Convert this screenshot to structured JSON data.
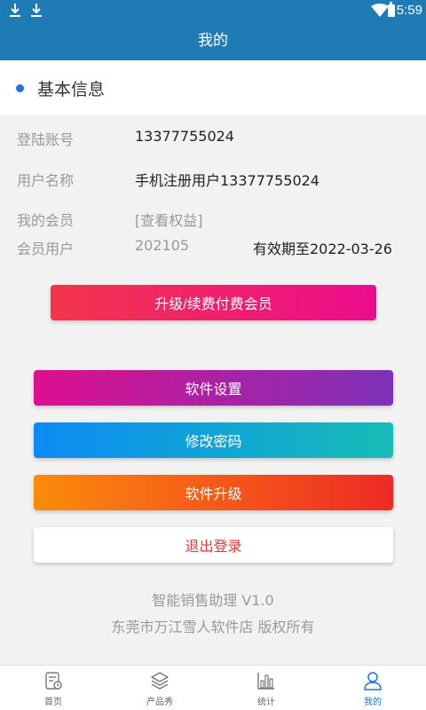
{
  "status_bar": {
    "time": "5:59"
  },
  "header": {
    "title": "我的"
  },
  "section": {
    "title": "基本信息"
  },
  "info": {
    "account_label": "登陆账号",
    "account_value": "13377755024",
    "username_label": "用户名称",
    "username_value": "手机注册用户13377755024",
    "membership_label": "我的会员",
    "membership_value": "[查看权益]",
    "member_user_label": "会员用户",
    "member_user_value": "202105",
    "expiry_text": "有效期至2022-03-26"
  },
  "buttons": {
    "upgrade": "升级/续费付费会员",
    "settings": "软件设置",
    "change_password": "修改密码",
    "software_update": "软件升级",
    "logout": "退出登录"
  },
  "footer": {
    "app_version": "智能销售助理 V1.0",
    "copyright": "东莞市万江雪人软件店 版权所有"
  },
  "tabbar": {
    "items": [
      {
        "label": "首页",
        "icon": "home-doc-icon"
      },
      {
        "label": "产品秀",
        "icon": "layers-icon"
      },
      {
        "label": "统计",
        "icon": "bar-chart-icon"
      },
      {
        "label": "我的",
        "icon": "user-icon"
      }
    ],
    "active_index": 3
  },
  "colors": {
    "primary": "#1e7bb4",
    "accent": "#1a73e8",
    "logout_text": "#e53935"
  }
}
